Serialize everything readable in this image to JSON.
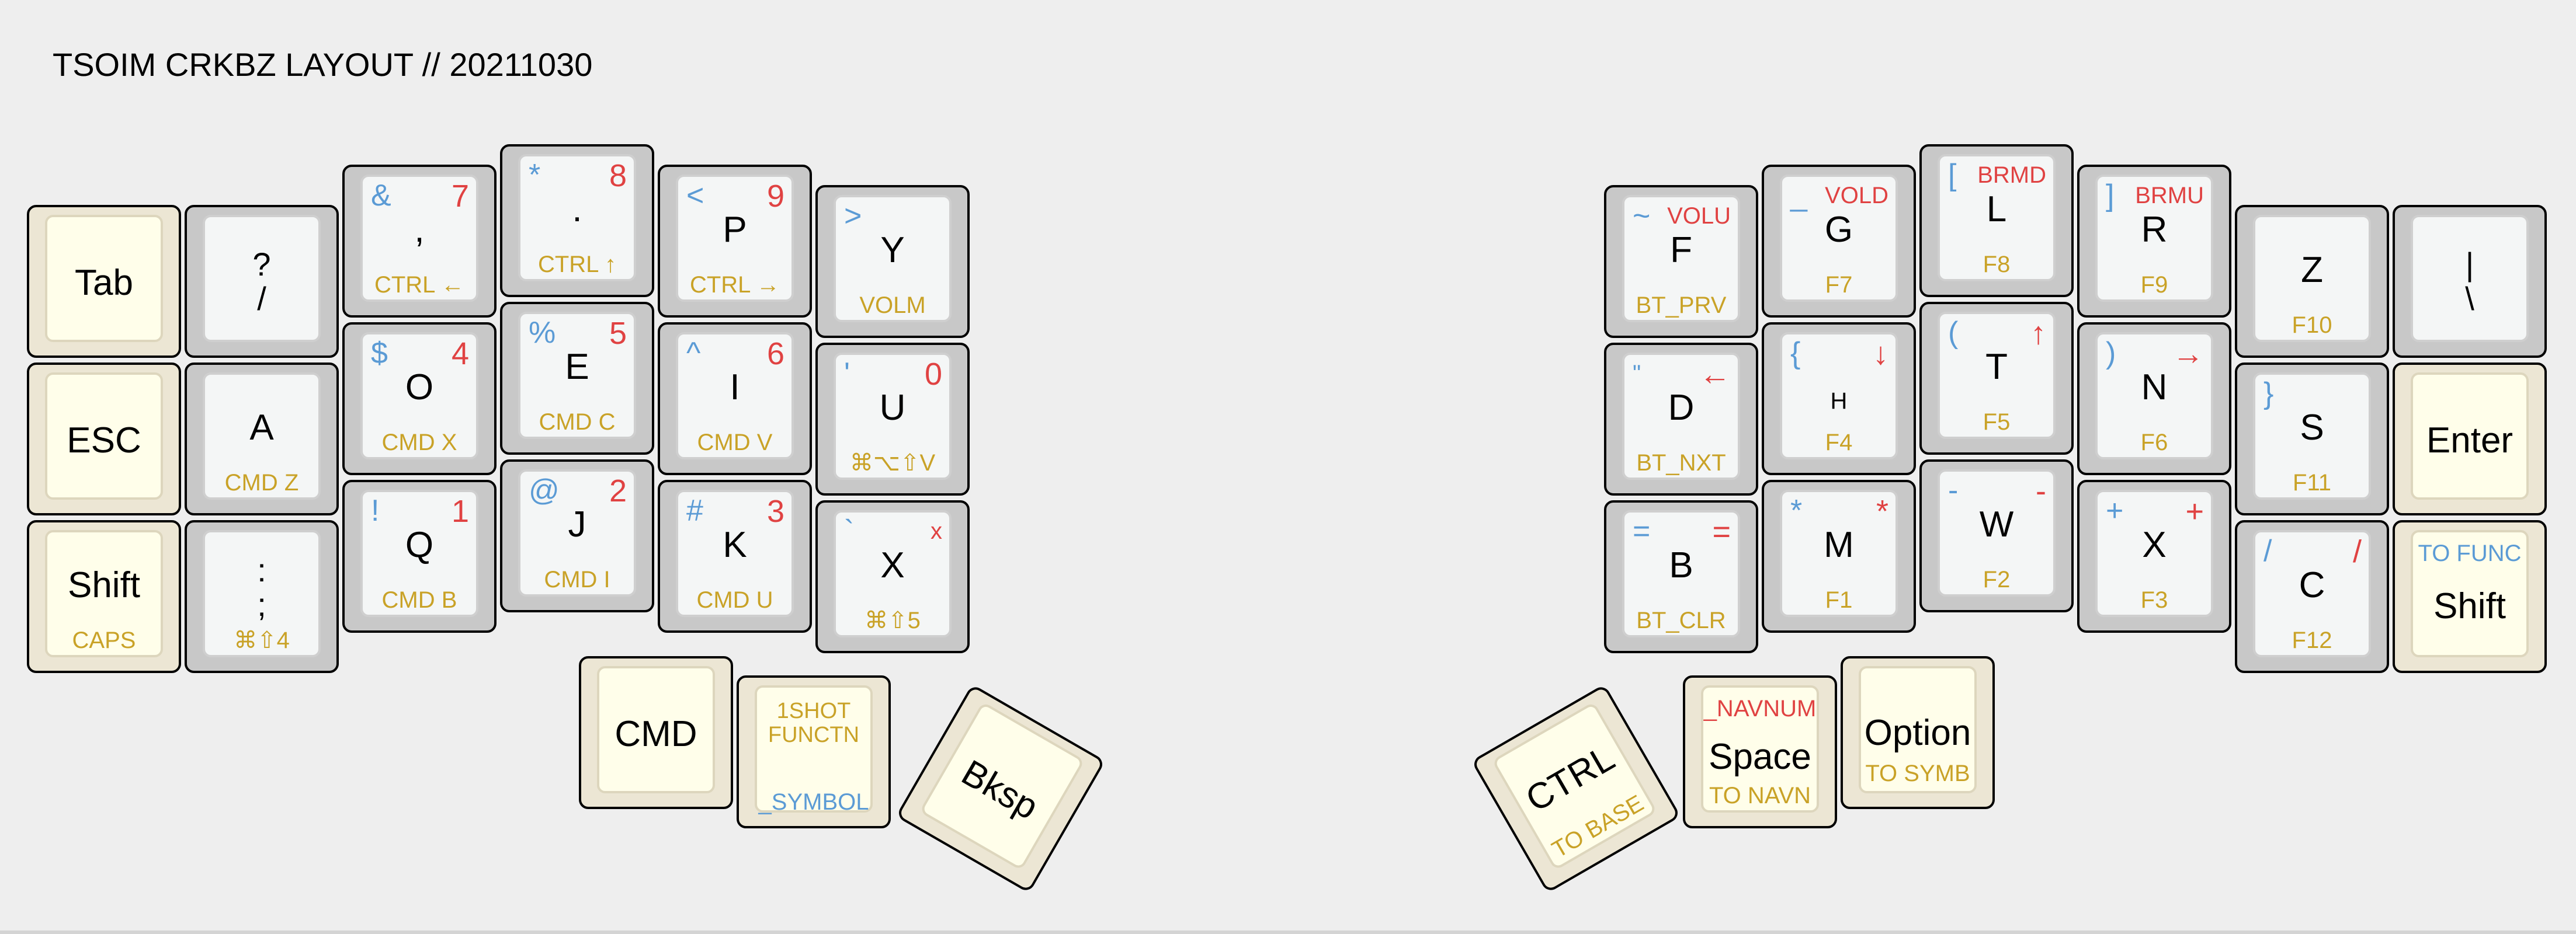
{
  "title": "TSOIM CRKBZ LAYOUT // 20211030",
  "colors": {
    "background": "#eeeeee",
    "key_alpha": "#c8c8c8",
    "key_mod": "#ece6d4",
    "cap_alpha": "#f4f6f6",
    "cap_mod": "#fffeea",
    "symbol_blue": "#5b9bd5",
    "number_red": "#e04242",
    "function_gold": "#c9a227"
  },
  "left": {
    "row1": [
      {
        "main": "Tab"
      },
      {
        "main": "?\n/"
      },
      {
        "main": ",",
        "tl": "&",
        "tr": "7",
        "sub": "CTRL ←"
      },
      {
        "main": ".",
        "tl": "*",
        "tr": "8",
        "sub": "CTRL ↑"
      },
      {
        "main": "P",
        "tl": "<",
        "tr": "9",
        "sub": "CTRL →"
      },
      {
        "main": "Y",
        "tl": ">",
        "sub": "VOLM"
      }
    ],
    "row2": [
      {
        "main": "ESC"
      },
      {
        "main": "A",
        "sub": "CMD Z"
      },
      {
        "main": "O",
        "tl": "$",
        "tr": "4",
        "sub": "CMD X"
      },
      {
        "main": "E",
        "tl": "%",
        "tr": "5",
        "sub": "CMD C"
      },
      {
        "main": "I",
        "tl": "^",
        "tr": "6",
        "sub": "CMD V"
      },
      {
        "main": "U",
        "tl": "'",
        "tr": "0",
        "sub": "⌘⌥⇧V"
      }
    ],
    "row3": [
      {
        "main": "Shift",
        "sub": "CAPS"
      },
      {
        "main": ":\n;",
        "sub": "⌘⇧4"
      },
      {
        "main": "Q",
        "tl": "!",
        "tr": "1",
        "sub": "CMD B"
      },
      {
        "main": "J",
        "tl": "@",
        "tr": "2",
        "sub": "CMD I"
      },
      {
        "main": "K",
        "tl": "#",
        "tr": "3",
        "sub": "CMD U"
      },
      {
        "main": "X",
        "tl": "`",
        "tr": "x",
        "sub": "⌘⇧5"
      }
    ],
    "thumbs": [
      {
        "main": "CMD"
      },
      {
        "top_sub": "1SHOT\nFUNCTN",
        "bottom": "_SYMBOL"
      },
      {
        "main": "Bksp"
      }
    ]
  },
  "right": {
    "row1": [
      {
        "main": "F",
        "tl": "~",
        "tr": "VOLU",
        "sub": "BT_PRV"
      },
      {
        "main": "G",
        "tl": "_",
        "tr": "VOLD",
        "sub": "F7"
      },
      {
        "main": "L",
        "tl": "[",
        "tr": "BRMD",
        "sub": "F8"
      },
      {
        "main": "R",
        "tl": "]",
        "tr": "BRMU",
        "sub": "F9"
      },
      {
        "main": "Z",
        "sub": "F10"
      },
      {
        "main": "|\n\\"
      }
    ],
    "row2": [
      {
        "main": "D",
        "tl": "\"",
        "tr": "←",
        "sub": "BT_NXT"
      },
      {
        "main": "H",
        "tl": "{",
        "tr": "↓",
        "sub": "F4"
      },
      {
        "main": "T",
        "tl": "(",
        "tr": "↑",
        "sub": "F5"
      },
      {
        "main": "N",
        "tl": ")",
        "tr": "→",
        "sub": "F6"
      },
      {
        "main": "S",
        "tl": "}",
        "sub": "F11"
      },
      {
        "main": "Enter"
      }
    ],
    "row3": [
      {
        "main": "B",
        "tl": "=",
        "tr": "=",
        "sub": "BT_CLR"
      },
      {
        "main": "M",
        "tl": "*",
        "tr": "*",
        "sub": "F1"
      },
      {
        "main": "W",
        "tl": "-",
        "tr": "-",
        "sub": "F2"
      },
      {
        "main": "X",
        "tl": "+",
        "tr": "+",
        "sub": "F3"
      },
      {
        "main": "C",
        "tl": "/",
        "tr": "/",
        "sub": "F12"
      },
      {
        "main": "Shift",
        "tc": "TO FUNC"
      }
    ],
    "thumbs": [
      {
        "main": "CTRL",
        "sub": "TO BASE"
      },
      {
        "main": "Space",
        "tc": "_NAVNUM",
        "sub": "TO NAVN"
      },
      {
        "main": "Option",
        "sub": "TO SYMB"
      }
    ]
  }
}
